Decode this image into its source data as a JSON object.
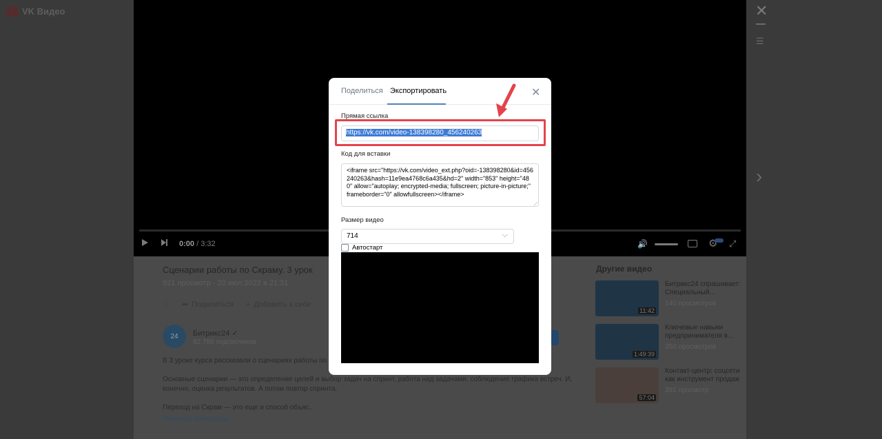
{
  "brand": {
    "name": "VK Видео"
  },
  "player": {
    "time_current": "0:00",
    "time_total": "3:32"
  },
  "video": {
    "title": "Сценарии работы по Скраму. 3 урок",
    "meta": "921 просмотр · 20 июл 2022 в 21:31",
    "share_label": "Поделиться",
    "add_label": "Добавить к себе",
    "channel_name": "Битрикс24",
    "channel_avatar": "24",
    "channel_subs": "82 786 подписчиков",
    "desc1": "В 3 уроке курса рассказали о сценариях работы по Скр",
    "desc2": "Основные сценарии — это определение целей и выбор задач на спринт, работа над задачами, соблюдение графика встреч. И,",
    "desc3": "конечно, оценка результатов. А потом повтор спринта.",
    "desc4": "Переход на Скрам — это еще и способ объяс..",
    "show_more": "Показать полностью..."
  },
  "sidebar": {
    "title": "Другие видео",
    "items": [
      {
        "title": "Битрикс24 спрашивает: Специальный...",
        "views": "140 просмотров",
        "duration": "11:42"
      },
      {
        "title": "Ключевые навыки предпринимателя в...",
        "views": "350 просмотров",
        "duration": "1:49:39"
      },
      {
        "title": "Контакт-центр: соцсети как инструмент продаж",
        "views": "391 просмотр",
        "duration": "57:04"
      }
    ]
  },
  "modal": {
    "tab_share": "Поделиться",
    "tab_export": "Экспортировать",
    "direct_link_label": "Прямая ссылка",
    "direct_link_value": "https://vk.com/video-138398280_456240263",
    "embed_label": "Код для вставки",
    "embed_code": "<iframe src=\"https://vk.com/video_ext.php?oid=-138398280&id=456240263&hash=11e9ea4768c6a435&hd=2\" width=\"853\" height=\"480\" allow=\"autoplay; encrypted-media; fullscreen; picture-in-picture;\" frameborder=\"0\" allowfullscreen></iframe>",
    "size_label": "Размер видео",
    "size_value": "714",
    "autostart_label": "Автостарт"
  },
  "colors": {
    "accent": "#5181b8",
    "highlight_box": "#e3434b",
    "selection": "#3d7bd6"
  },
  "icons": [
    "play-icon",
    "next-icon",
    "volume-icon",
    "subtitles-icon",
    "settings-icon",
    "fullscreen-icon",
    "close-icon",
    "playlist-icon",
    "chevron-right-icon",
    "heart-icon",
    "share-icon",
    "plus-icon",
    "verified-icon",
    "chevron-down-icon",
    "red-arrow-annotation"
  ]
}
